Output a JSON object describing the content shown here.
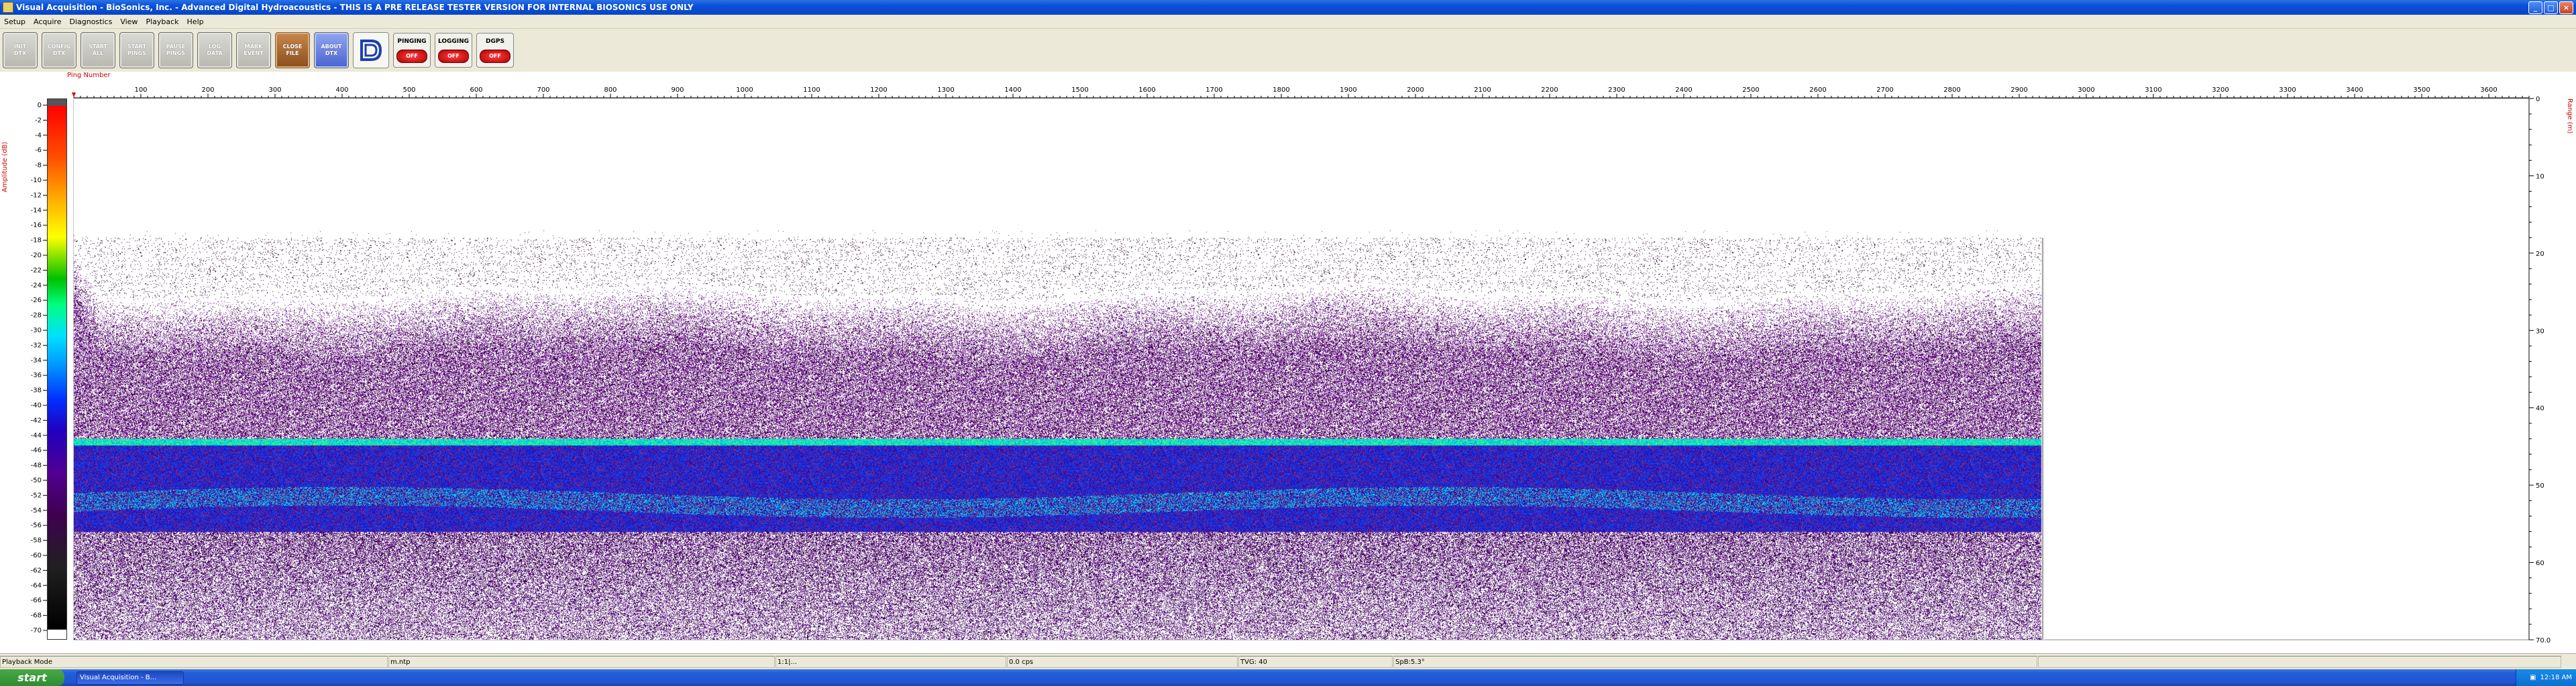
{
  "window": {
    "title": "Visual Acquisition  -  BioSonics, Inc.   -   Advanced Digital Hydroacoustics   -   THIS IS A PRE RELEASE TESTER VERSION FOR INTERNAL BIOSONICS USE ONLY",
    "minimize_label": "_",
    "maximize_label": "□",
    "close_label": "×"
  },
  "menu": [
    "Setup",
    "Acquire",
    "Diagnostics",
    "View",
    "Playback",
    "Help"
  ],
  "toolbar": {
    "buttons": [
      {
        "label": "INIT\nDTX",
        "style": "gray"
      },
      {
        "label": "CONFIG\nDTX",
        "style": "gray"
      },
      {
        "label": "START\nALL",
        "style": "gray"
      },
      {
        "label": "START\nPINGS",
        "style": "gray"
      },
      {
        "label": "PAUSE\nPINGS",
        "style": "gray"
      },
      {
        "label": "LOG\nDATA",
        "style": "gray"
      },
      {
        "label": "MARK\nEVENT",
        "style": "gray"
      },
      {
        "label": "CLOSE\nFILE",
        "style": "orange"
      },
      {
        "label": "ABOUT\nDTX",
        "style": "blue"
      }
    ],
    "indicators": [
      {
        "label": "PINGING",
        "state": "OFF"
      },
      {
        "label": "LOGGING",
        "state": "OFF"
      },
      {
        "label": "DGPS",
        "state": "OFF"
      }
    ]
  },
  "echogram": {
    "x_axis_title": "Ping Number",
    "left_axis_title": "Amplitude (dB)",
    "right_axis_title": "Range (m)",
    "x_ticks": [
      100,
      200,
      300,
      400,
      500,
      600,
      700,
      800,
      900,
      1000,
      1100,
      1200,
      1300,
      1400,
      1500,
      1600,
      1700,
      1800,
      1900,
      2000,
      2100,
      2200,
      2300,
      2400,
      2500,
      2600,
      2700,
      2800,
      2900,
      3000,
      3100,
      3200,
      3300,
      3400,
      3500,
      3600
    ],
    "x_range": [
      0,
      3660
    ],
    "amplitude_ticks": [
      0,
      -2,
      -4,
      -6,
      -8,
      -10,
      -12,
      -14,
      -16,
      -18,
      -20,
      -22,
      -24,
      -26,
      -28,
      -30,
      -32,
      -34,
      -36,
      -38,
      -40,
      -42,
      -44,
      -46,
      -48,
      -50,
      -52,
      -54,
      -56,
      -58,
      -60,
      -62,
      -64,
      -66,
      -68,
      -70
    ],
    "range_ticks": [
      0,
      10,
      20,
      30,
      40,
      50,
      60,
      70.0
    ],
    "range_max": 70,
    "last_ping": 2935,
    "noise_top_range_m": 22,
    "bottom_band_range_m": [
      44,
      56
    ]
  },
  "status": {
    "fields": [
      "Playback Mode",
      "m.ntp",
      "1:1|...",
      "0.0 cps",
      "TVG: 40",
      "SpB:5.3°",
      ""
    ]
  },
  "taskbar": {
    "start_label": "start",
    "task_label": "Visual Acquisition  -  B...",
    "clock": "12:18 AM"
  }
}
